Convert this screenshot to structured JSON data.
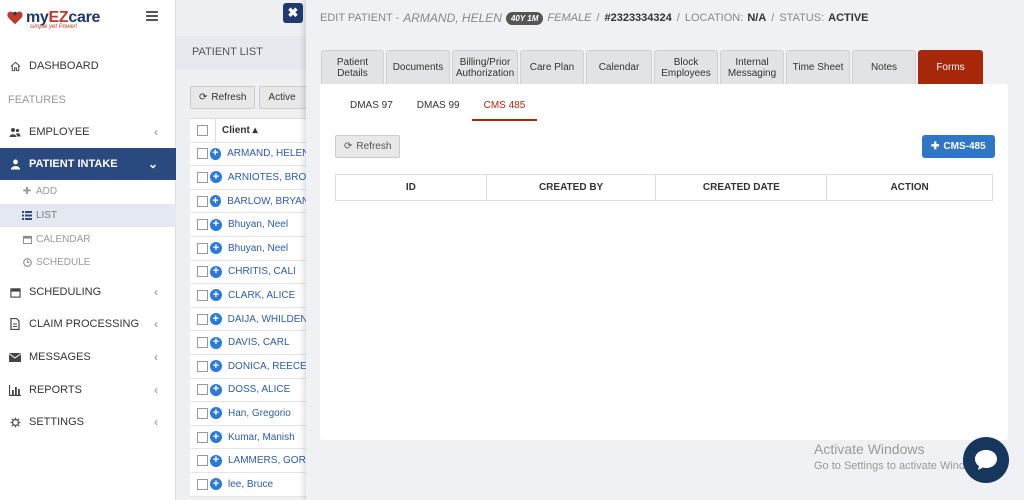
{
  "logo": {
    "prefix": "my",
    "brand_ez": "EZ",
    "brand_care": "care",
    "tagline": "simple yet Power!"
  },
  "sidebar": {
    "section_label": "FEATURES",
    "items": [
      {
        "label": "DASHBOARD",
        "icon": "home-icon"
      },
      {
        "label": "EMPLOYEE",
        "icon": "users-icon"
      },
      {
        "label": "PATIENT INTAKE",
        "icon": "user-icon"
      },
      {
        "label": "SCHEDULING",
        "icon": "calendar-icon"
      },
      {
        "label": "CLAIM PROCESSING",
        "icon": "document-icon"
      },
      {
        "label": "MESSAGES",
        "icon": "envelope-icon"
      },
      {
        "label": "REPORTS",
        "icon": "bar-chart-icon"
      },
      {
        "label": "SETTINGS",
        "icon": "gear-icon"
      }
    ],
    "sub_items": [
      {
        "label": "ADD",
        "icon": "plus-icon"
      },
      {
        "label": "LIST",
        "icon": "list-icon"
      },
      {
        "label": "CALENDAR",
        "icon": "calendar-icon"
      },
      {
        "label": "SCHEDULE",
        "icon": "clock-icon"
      }
    ]
  },
  "patient_list": {
    "title": "PATIENT LIST",
    "refresh_label": "Refresh",
    "filter_label": "Active",
    "column_header": "Client",
    "rows": [
      "ARMAND, HELEN",
      "ARNIOTES, BRO",
      "BARLOW, BRYAN",
      "Bhuyan, Neel",
      "Bhuyan, Neel",
      "CHRITIS, CALI",
      "CLARK, ALICE",
      "DAIJA, WHILDEN",
      "DAVIS, CARL",
      "DONICA, REECE",
      "DOSS, ALICE",
      "Han, Gregorio",
      "Kumar, Manish",
      "LAMMERS, GOR",
      "lee, Bruce"
    ]
  },
  "edit_panel": {
    "title_label": "EDIT PATIENT -",
    "patient_name": "ARMAND, HELEN",
    "age_badge": "40Y 1M",
    "gender": "FEMALE",
    "separator": "/",
    "patient_id": "#2323334324",
    "location_label": "LOCATION:",
    "location_value": "N/A",
    "status_label": "STATUS:",
    "status_value": "ACTIVE",
    "close_label": "✖",
    "tabs": [
      {
        "label": "Patient Details"
      },
      {
        "label": "Documents"
      },
      {
        "label": "Billing/Prior Authorization"
      },
      {
        "label": "Care Plan"
      },
      {
        "label": "Calendar"
      },
      {
        "label": "Block Employees"
      },
      {
        "label": "Internal Messaging"
      },
      {
        "label": "Time Sheet"
      },
      {
        "label": "Notes"
      },
      {
        "label": "Forms"
      }
    ],
    "sub_tabs": [
      "DMAS 97",
      "DMAS 99",
      "CMS 485"
    ],
    "refresh_label": "Refresh",
    "add_button_label": "CMS-485",
    "table_headers": [
      "ID",
      "CREATED BY",
      "CREATED DATE",
      "ACTION"
    ]
  },
  "watermark": {
    "line1": "Activate Windows",
    "line2": "Go to Settings to activate Windows."
  },
  "colors": {
    "sidebar_active": "#2a4a7f",
    "tab_active": "#a8280c",
    "primary_button": "#2f77c6",
    "close_button": "#1e3a6e",
    "chat_button": "#16365e"
  }
}
